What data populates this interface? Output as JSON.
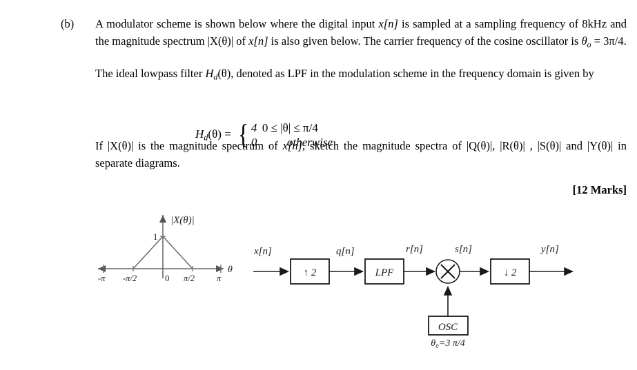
{
  "question": {
    "label": "(b)",
    "paragraph1_parts": {
      "a": "A  modulator scheme is shown below where the digital input ",
      "x_of_n": "x[n]",
      "b": " is sampled at a sampling frequency of 8kHz and the magnitude spectrum |X(θ)| of ",
      "c": " is also given below. The carrier frequency of the cosine oscillator is ",
      "theta_sub": "o",
      "theta_eq": " = 3π/4."
    },
    "paragraph2_parts": {
      "a": "The ideal lowpass filter ",
      "hd": "H",
      "hd_sub": "d",
      "b": "(θ), denoted as LPF in the modulation scheme in the frequency domain is given by"
    },
    "equation": {
      "lhs": "H",
      "lhs_sub": "d",
      "lhs_rest": "(θ) =",
      "case1_value": "4",
      "case1_condition": "0 ≤ |θ| ≤ π/4",
      "case2_value": "0",
      "case2_condition": "otherwise"
    },
    "paragraph3_parts": {
      "a": "If |X(θ)| is the magnitude spectrum of  ",
      "x_of_n": "x[n]",
      "b": ", sketch the magnitude spectra of |Q(θ)|, |R(θ)| , |S(θ)| and |Y(θ)| in separate diagrams."
    },
    "marks": "[12 Marks]"
  },
  "spectrum_plot": {
    "title": "|X(θ)|",
    "peak_label": "1",
    "x_axis_label": "θ",
    "x_ticks": [
      "-π",
      "-π/2",
      "0",
      "π/2",
      "π"
    ]
  },
  "chart_data": {
    "type": "line",
    "title": "|X(θ)|",
    "xlabel": "θ",
    "ylabel": "|X(θ)|",
    "xlim": [
      -3.14159,
      3.14159
    ],
    "ylim": [
      0,
      1.15
    ],
    "grid": false,
    "legend": "none",
    "xtick_labels": [
      "-π",
      "-π/2",
      "0",
      "π/2",
      "π"
    ],
    "xtick_values": [
      -3.14159,
      -1.5708,
      0,
      1.5708,
      3.14159
    ],
    "ytick_labels": [
      "1"
    ],
    "ytick_values": [
      1
    ],
    "series": [
      {
        "name": "|X(θ)|",
        "x": [
          -3.14159,
          -1.5708,
          0,
          1.5708,
          3.14159
        ],
        "y": [
          0,
          0,
          1,
          0,
          0
        ]
      }
    ],
    "description": "Triangular magnitude spectrum peaking at 1 at θ=0 and decaying linearly to 0 at ±π/2, zero elsewhere up to ±π."
  },
  "block_diagram": {
    "signals": {
      "input": "x[n]",
      "after_upsampler": "q[n]",
      "after_lpf": "r[n]",
      "after_mixer": "s[n]",
      "output": "y[n]"
    },
    "blocks": {
      "upsampler": "↑ 2",
      "lpf": "LPF",
      "downsampler": "↓ 2",
      "oscillator": "OSC",
      "mixer": "×"
    },
    "oscillator_param": "θ₀=3 π/4"
  }
}
